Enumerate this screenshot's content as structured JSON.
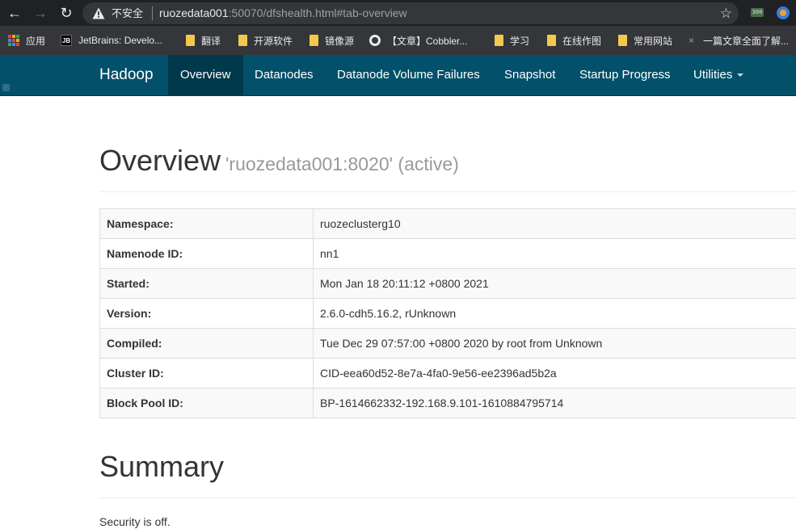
{
  "browser": {
    "security_label": "不安全",
    "url_host": "ruozedata001",
    "url_rest": ":50070/dfshealth.html#tab-overview",
    "bookmarks": [
      {
        "label": "应用",
        "icon": "apps-icon"
      },
      {
        "label": "JetBrains: Develo...",
        "icon": "jetbrains-icon"
      },
      {
        "label": "翻译",
        "icon": "folder-icon"
      },
      {
        "label": "开源软件",
        "icon": "folder-icon"
      },
      {
        "label": "镜像源",
        "icon": "folder-icon"
      },
      {
        "label": "【文章】Cobbler...",
        "icon": "globe-icon"
      },
      {
        "label": "学习",
        "icon": "folder-icon"
      },
      {
        "label": "在线作图",
        "icon": "folder-icon"
      },
      {
        "label": "常用网站",
        "icon": "folder-icon"
      },
      {
        "label": "一篇文章全面了解...",
        "icon": "x-icon"
      }
    ],
    "ext1_label": "300"
  },
  "navbar": {
    "brand": "Hadoop",
    "items": [
      {
        "label": "Overview",
        "active": true
      },
      {
        "label": "Datanodes"
      },
      {
        "label": "Datanode Volume Failures"
      },
      {
        "label": "Snapshot"
      },
      {
        "label": "Startup Progress"
      },
      {
        "label": "Utilities",
        "dropdown": true
      }
    ]
  },
  "overview": {
    "title": "Overview",
    "subtitle": "'ruozedata001:8020' (active)",
    "rows": [
      {
        "key": "Namespace:",
        "value": "ruozeclusterg10"
      },
      {
        "key": "Namenode ID:",
        "value": "nn1"
      },
      {
        "key": "Started:",
        "value": "Mon Jan 18 20:11:12 +0800 2021"
      },
      {
        "key": "Version:",
        "value": "2.6.0-cdh5.16.2, rUnknown"
      },
      {
        "key": "Compiled:",
        "value": "Tue Dec 29 07:57:00 +0800 2020 by root from Unknown"
      },
      {
        "key": "Cluster ID:",
        "value": "CID-eea60d52-8e7a-4fa0-9e56-ee2396ad5b2a"
      },
      {
        "key": "Block Pool ID:",
        "value": "BP-1614662332-192.168.9.101-1610884795714"
      }
    ]
  },
  "summary": {
    "title": "Summary",
    "security_text": "Security is off."
  },
  "colors": {
    "navbar_bg": "#025069",
    "navbar_active": "#01394c",
    "chrome_bg": "#202124",
    "bookmark_bar_bg": "#35363a"
  }
}
